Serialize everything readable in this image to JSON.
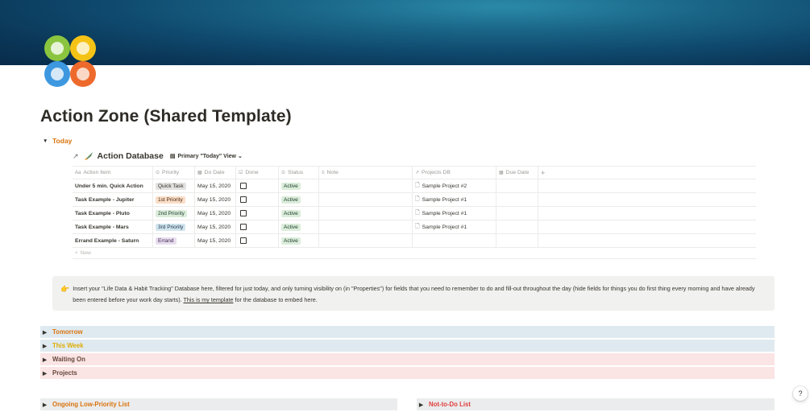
{
  "page": {
    "title": "Action Zone (Shared Template)",
    "icon": "four-color-circles-icon"
  },
  "today_toggle": {
    "label": "Today"
  },
  "database": {
    "title": "Action Database",
    "view_label": "Primary \"Today\" View",
    "columns": [
      "Action Item",
      "Priority",
      "Do Date",
      "Done",
      "Status",
      "Note",
      "Projects DB",
      "Due Date"
    ],
    "add_column": "+",
    "rows": [
      {
        "item": "Under 5 min. Quick Action",
        "priority": "Quick Task",
        "do_date": "May 15, 2020",
        "status": "Active",
        "project": "Sample Project #2"
      },
      {
        "item": "Task Example - Jupiter",
        "priority": "1st Priority",
        "do_date": "May 15, 2020",
        "status": "Active",
        "project": "Sample Project #1"
      },
      {
        "item": "Task Example - Pluto",
        "priority": "2nd Priority",
        "do_date": "May 15, 2020",
        "status": "Active",
        "project": "Sample Project #1"
      },
      {
        "item": "Task Example - Mars",
        "priority": "3rd Priority",
        "do_date": "May 15, 2020",
        "status": "Active",
        "project": "Sample Project #1"
      },
      {
        "item": "Errand Example - Saturn",
        "priority": "Errand",
        "do_date": "May 15, 2020",
        "status": "Active",
        "project": ""
      }
    ],
    "new_label": "New"
  },
  "callout": {
    "icon": "pointing-hand-icon",
    "text_before": "Insert your \"Life Data & Habit Tracking\" Database here, filtered for just today, and only turning visibility on (in \"Properties\") for fields that you need to remember to do and fill-out throughout the day (hide fields for things you do first thing every morning and have already been entered before your work day starts). ",
    "link_text": "This is my template",
    "text_after": " for the database to embed here."
  },
  "sections": {
    "tomorrow": "Tomorrow",
    "this_week": "This Week",
    "waiting_on": "Waiting On",
    "projects": "Projects",
    "ongoing": "Ongoing Low-Priority List",
    "not_to_do": "Not-to-Do List"
  },
  "help_button": "?",
  "colors": {
    "orange": "#d9730d",
    "yellow": "#dfab01",
    "red": "#e03e3e",
    "blue_bg": "#dfeaf0",
    "red_bg": "#fbe4e4",
    "gray_bg": "#ebeced"
  }
}
